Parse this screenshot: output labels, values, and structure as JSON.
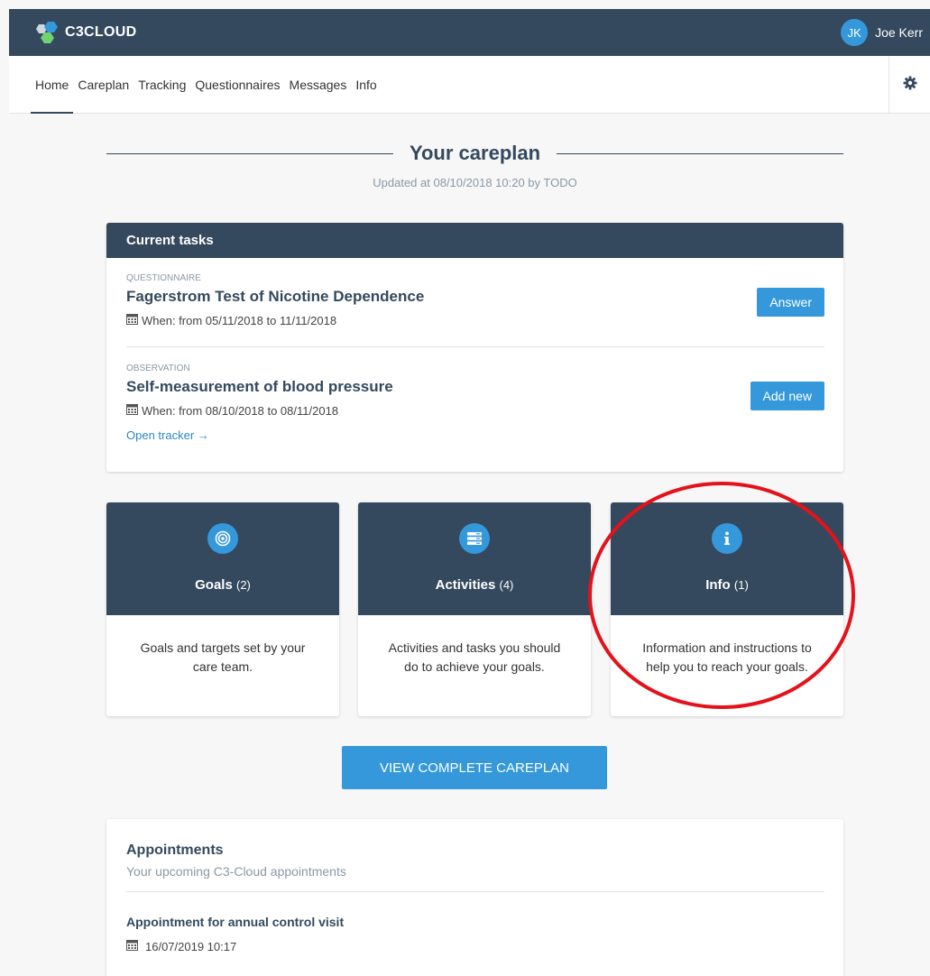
{
  "brand": {
    "name": "C3CLOUD"
  },
  "user": {
    "initials": "JK",
    "name": "Joe Kerr"
  },
  "nav": {
    "tabs": [
      {
        "label": "Home",
        "active": true
      },
      {
        "label": "Careplan"
      },
      {
        "label": "Tracking"
      },
      {
        "label": "Questionnaires"
      },
      {
        "label": "Messages"
      },
      {
        "label": "Info"
      }
    ],
    "settings_icon": "gear-icon"
  },
  "careplan": {
    "title": "Your careplan",
    "updated": "Updated at 08/10/2018 10:20 by TODO"
  },
  "tasks": {
    "header": "Current tasks",
    "items": [
      {
        "type": "QUESTIONNAIRE",
        "title": "Fagerstrom Test of Nicotine Dependence",
        "when": "When: from 05/11/2018 to 11/11/2018",
        "action": "Answer"
      },
      {
        "type": "OBSERVATION",
        "title": "Self-measurement of blood pressure",
        "when": "When: from 08/10/2018 to 08/11/2018",
        "action": "Add new",
        "link": "Open tracker →"
      }
    ]
  },
  "categories": [
    {
      "title": "Goals",
      "count": "(2)",
      "icon": "target-icon",
      "desc": "Goals and targets set by your care team."
    },
    {
      "title": "Activities",
      "count": "(4)",
      "icon": "list-icon",
      "desc": "Activities and tasks you should do to achieve your goals."
    },
    {
      "title": "Info",
      "count": "(1)",
      "icon": "info-icon",
      "desc": "Information and instructions to help you to reach your goals."
    }
  ],
  "view_complete": "VIEW COMPLETE CAREPLAN",
  "appointments": {
    "title": "Appointments",
    "subtitle": "Your upcoming C3-Cloud appointments",
    "items": [
      {
        "title": "Appointment for annual control visit",
        "date": "16/07/2019 10:17"
      }
    ]
  },
  "colors": {
    "header_bg": "#34495e",
    "accent": "#3498db",
    "annotation": "#e3121b"
  }
}
